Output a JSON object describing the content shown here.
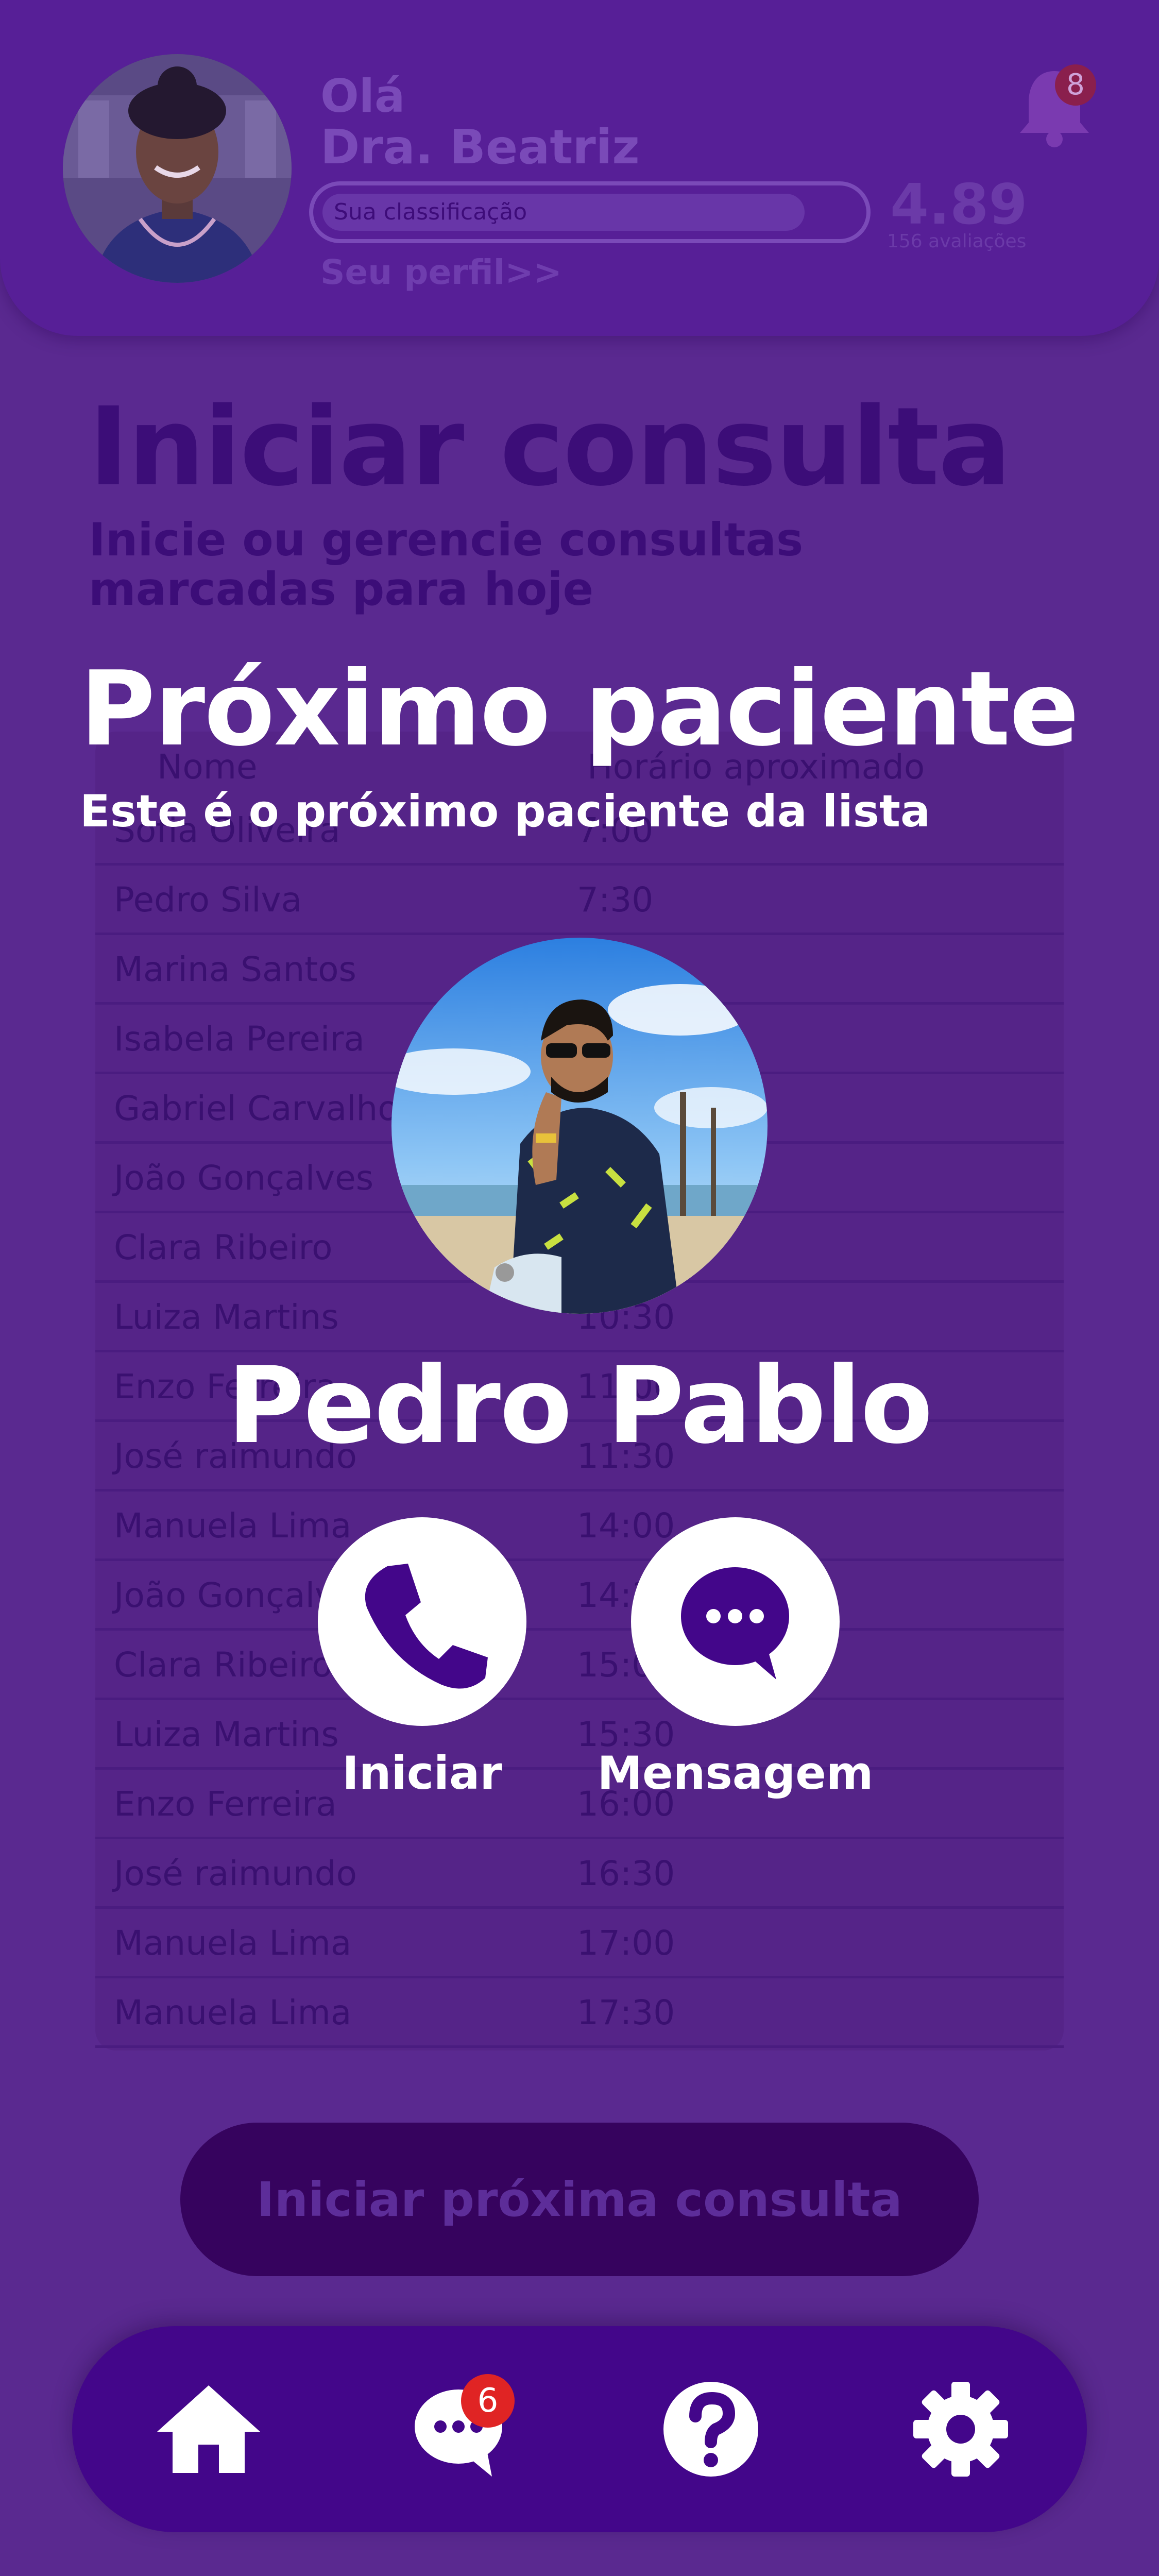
{
  "header": {
    "hello": "Olá",
    "doctor_name": "Dra. Beatriz",
    "rating_label": "Sua classificação",
    "rating_value": "4.89",
    "rating_count": "156 avaliações",
    "rating_fill_fraction": 0.9,
    "profile_link": "Seu perfil>>",
    "notifications_count": "8",
    "bell_icon": "bell-icon"
  },
  "main": {
    "title": "Iniciar consulta",
    "subtitle": "Inicie ou gerencie consultas marcadas para hoje",
    "table": {
      "columns": [
        "Nome",
        "Horário aproximado"
      ],
      "rows": [
        {
          "name": "Sofia Oliveira",
          "time": "7:00"
        },
        {
          "name": "Pedro Silva",
          "time": "7:30"
        },
        {
          "name": "Marina Santos",
          "time": ""
        },
        {
          "name": "Isabela Pereira",
          "time": ""
        },
        {
          "name": "Gabriel Carvalho",
          "time": ""
        },
        {
          "name": "João Gonçalves",
          "time": ""
        },
        {
          "name": "Clara Ribeiro",
          "time": ""
        },
        {
          "name": "Luiza Martins",
          "time": "10:30"
        },
        {
          "name": "Enzo Ferreira",
          "time": "11:00"
        },
        {
          "name": "José raimundo",
          "time": "11:30"
        },
        {
          "name": "Manuela Lima",
          "time": "14:00"
        },
        {
          "name": "João Gonçalves",
          "time": "14:30"
        },
        {
          "name": "Clara Ribeiro",
          "time": "15:00"
        },
        {
          "name": "Luiza Martins",
          "time": "15:30"
        },
        {
          "name": "Enzo Ferreira",
          "time": "16:00"
        },
        {
          "name": "José raimundo",
          "time": "16:30"
        },
        {
          "name": "Manuela Lima",
          "time": "17:00"
        },
        {
          "name": "Manuela Lima",
          "time": "17:30"
        }
      ]
    },
    "start_next_button": "Iniciar próxima consulta"
  },
  "modal": {
    "title": "Próximo paciente",
    "subtitle": "Este é o próximo paciente da lista",
    "patient_name": "Pedro Pablo",
    "start_label": "Iniciar",
    "message_label": "Mensagem",
    "start_icon": "phone-icon",
    "message_icon": "chat-bubble-icon"
  },
  "bottom_nav": {
    "items": [
      "home-icon",
      "chat-icon",
      "help-icon",
      "settings-icon"
    ],
    "chat_badge": "6"
  },
  "colors": {
    "background": "#5a2990",
    "header": "#571f97",
    "nav": "#43068a",
    "accent_dark": "#3c0d78",
    "badge_red": "#e02424",
    "white": "#ffffff"
  }
}
